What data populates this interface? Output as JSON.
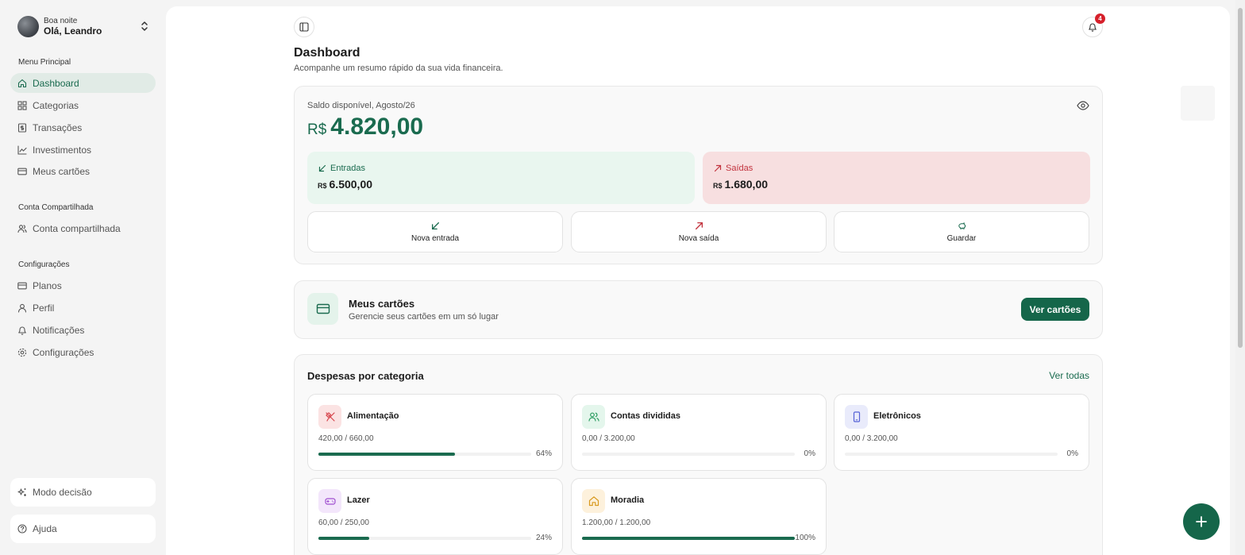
{
  "user": {
    "greeting": "Boa noite",
    "name": "Olá, Leandro"
  },
  "sidebar": {
    "sections": [
      {
        "title": "Menu Principal"
      },
      {
        "title": "Conta Compartilhada"
      },
      {
        "title": "Configurações"
      }
    ],
    "items": [
      {
        "label": "Dashboard",
        "icon": "home-icon",
        "active": true
      },
      {
        "label": "Categorias",
        "icon": "grid-icon"
      },
      {
        "label": "Transações",
        "icon": "receipt-icon"
      },
      {
        "label": "Investimentos",
        "icon": "chart-line-icon"
      },
      {
        "label": "Meus cartões",
        "icon": "credit-card-icon"
      },
      {
        "label": "Conta compartilhada",
        "icon": "users-icon"
      },
      {
        "label": "Planos",
        "icon": "credit-card-icon"
      },
      {
        "label": "Perfil",
        "icon": "user-icon"
      },
      {
        "label": "Notificações",
        "icon": "bell-icon"
      },
      {
        "label": "Configurações",
        "icon": "gear-icon"
      }
    ],
    "bottom": [
      {
        "label": "Modo decisão",
        "icon": "sparkles-icon"
      },
      {
        "label": "Ajuda",
        "icon": "help-circle-icon"
      }
    ]
  },
  "header": {
    "notifications_count": "4",
    "title": "Dashboard",
    "subtitle": "Acompanhe um resumo rápido da sua vida financeira."
  },
  "balance": {
    "label": "Saldo disponível, Agosto/26",
    "currency": "R$",
    "value": "4.820,00",
    "income": {
      "label": "Entradas",
      "currency": "R$",
      "value": "6.500,00"
    },
    "expenses": {
      "label": "Saídas",
      "currency": "R$",
      "value": "1.680,00"
    },
    "actions": [
      {
        "label": "Nova entrada",
        "icon": "arrow-down-left-icon"
      },
      {
        "label": "Nova saída",
        "icon": "arrow-up-right-icon"
      },
      {
        "label": "Guardar",
        "icon": "piggy-bank-icon"
      }
    ]
  },
  "cards_section": {
    "title": "Meus cartões",
    "subtitle": "Gerencie seus cartões em um só lugar",
    "button": "Ver cartões"
  },
  "categories": {
    "title": "Despesas por categoria",
    "link": "Ver todas",
    "items": [
      {
        "name": "Alimentação",
        "amount": "420,00 / 660,00",
        "percent": "64%",
        "fill": 0.64,
        "icon": "utensils-icon",
        "icon_bg": "#fbe3e3",
        "icon_color": "#d6434b"
      },
      {
        "name": "Contas divididas",
        "amount": "0,00 / 3.200,00",
        "percent": "0%",
        "fill": 0,
        "icon": "users-icon",
        "icon_bg": "#e4f6ec",
        "icon_color": "#2f9e63"
      },
      {
        "name": "Eletrônicos",
        "amount": "0,00 / 3.200,00",
        "percent": "0%",
        "fill": 0,
        "icon": "smartphone-icon",
        "icon_bg": "#e9ebfb",
        "icon_color": "#5662d6"
      },
      {
        "name": "Lazer",
        "amount": "60,00 / 250,00",
        "percent": "24%",
        "fill": 0.24,
        "icon": "gamepad-icon",
        "icon_bg": "#f3e6fb",
        "icon_color": "#a04fd0"
      },
      {
        "name": "Moradia",
        "amount": "1.200,00 / 1.200,00",
        "percent": "100%",
        "fill": 1.0,
        "icon": "home-icon",
        "icon_bg": "#fdf1dc",
        "icon_color": "#d99a1f"
      }
    ]
  },
  "colors": {
    "primary": "#15664a",
    "income_bg": "#e9f6ef",
    "expense_bg": "#f7dfe0",
    "badge": "#d6202b"
  }
}
